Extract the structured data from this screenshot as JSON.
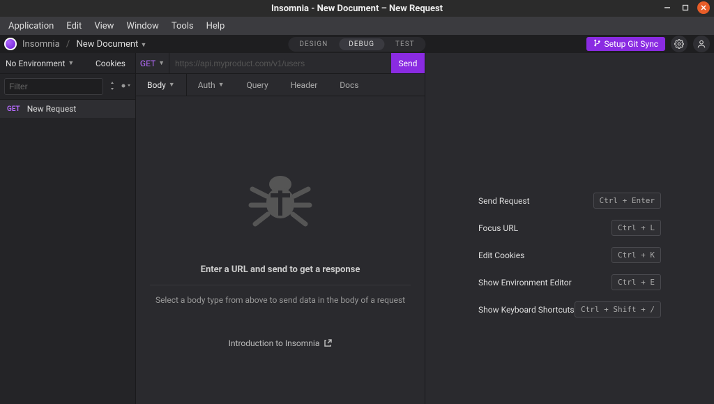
{
  "window_title": "Insomnia - New Document – New Request",
  "menu": [
    "Application",
    "Edit",
    "View",
    "Window",
    "Tools",
    "Help"
  ],
  "breadcrumb": {
    "app": "Insomnia",
    "doc": "New Document"
  },
  "modes": {
    "design": "DESIGN",
    "debug": "DEBUG",
    "test": "TEST"
  },
  "git_sync": "Setup Git Sync",
  "sidebar": {
    "env_label": "No Environment",
    "cookies": "Cookies",
    "filter_placeholder": "Filter",
    "request": {
      "method": "GET",
      "name": "New Request"
    }
  },
  "request": {
    "method": "GET",
    "url_placeholder": "https://api.myproduct.com/v1/users",
    "send": "Send",
    "tabs": {
      "body": "Body",
      "auth": "Auth",
      "query": "Query",
      "header": "Header",
      "docs": "Docs"
    }
  },
  "empty": {
    "title": "Enter a URL and send to get a response",
    "subtitle": "Select a body type from above to send data in the body of a request",
    "intro": "Introduction to Insomnia"
  },
  "shortcuts": [
    {
      "label": "Send Request",
      "keys": "Ctrl + Enter"
    },
    {
      "label": "Focus URL",
      "keys": "Ctrl + L"
    },
    {
      "label": "Edit Cookies",
      "keys": "Ctrl + K"
    },
    {
      "label": "Show Environment Editor",
      "keys": "Ctrl + E"
    },
    {
      "label": "Show Keyboard Shortcuts",
      "keys": "Ctrl + Shift + /"
    }
  ]
}
